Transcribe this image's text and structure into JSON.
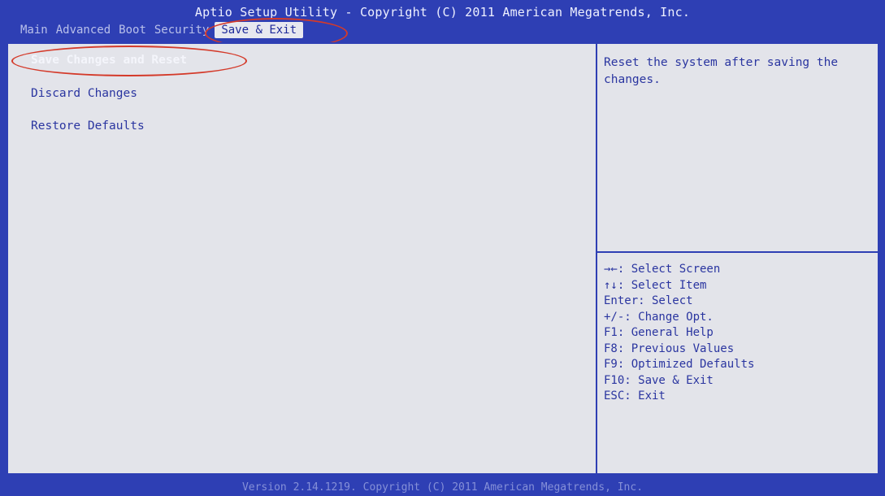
{
  "header": {
    "title": "Aptio Setup Utility - Copyright (C) 2011 American Megatrends, Inc.",
    "tabs": [
      {
        "label": "Main"
      },
      {
        "label": "Advanced"
      },
      {
        "label": "Boot"
      },
      {
        "label": "Security"
      },
      {
        "label": "Save & Exit"
      }
    ],
    "active_tab": "Save & Exit"
  },
  "menu": {
    "items": [
      {
        "label": "Save Changes and Reset"
      },
      {
        "label": "Discard Changes"
      },
      {
        "label": "Restore Defaults"
      }
    ],
    "selected": "Save Changes and Reset"
  },
  "help": {
    "description": "Reset the system after saving the changes.",
    "keys": [
      "→←: Select Screen",
      "↑↓: Select Item",
      "Enter: Select",
      "+/-: Change Opt.",
      "F1: General Help",
      "F8: Previous Values",
      "F9: Optimized Defaults",
      "F10: Save & Exit",
      "ESC: Exit"
    ]
  },
  "footer": {
    "version": "Version 2.14.1219. Copyright (C) 2011 American Megatrends, Inc."
  },
  "colors": {
    "background_blue": "#2e3fb4",
    "panel_gray": "#e3e4ea",
    "text_blue": "#2a35a0",
    "highlight_red": "#d43a2a"
  }
}
